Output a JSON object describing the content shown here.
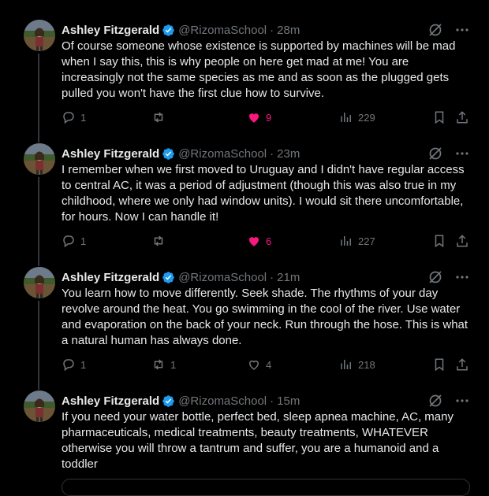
{
  "tweets": [
    {
      "author": "Ashley Fitzgerald",
      "handle": "@RizomaSchool",
      "time": "28m",
      "text": "Of course someone whose existence is supported by machines will be mad when I say this, this is why people on here get mad at me! You are increasingly not the same species as me and as soon as the plugged gets pulled you won't have the first clue how to survive.",
      "replies": "1",
      "reposts": "",
      "likes": "9",
      "liked": true,
      "views": "229"
    },
    {
      "author": "Ashley Fitzgerald",
      "handle": "@RizomaSchool",
      "time": "23m",
      "text": "I remember when we first moved to Uruguay and I didn't have regular access to central AC, it was a period of adjustment (though this was also true in my childhood, where we only had window units). I would sit there uncomfortable, for hours. Now I can handle it!",
      "replies": "1",
      "reposts": "",
      "likes": "6",
      "liked": true,
      "views": "227"
    },
    {
      "author": "Ashley Fitzgerald",
      "handle": "@RizomaSchool",
      "time": "21m",
      "text": "You learn how to move differently. Seek shade. The rhythms of your day revolve around the heat. You go swimming in the cool of the river. Use water and evaporation on the back of your neck. Run through the hose. This is what a natural human has always done.",
      "replies": "1",
      "reposts": "1",
      "likes": "4",
      "liked": false,
      "views": "218"
    },
    {
      "author": "Ashley Fitzgerald",
      "handle": "@RizomaSchool",
      "time": "15m",
      "text": "If you need your water bottle, perfect bed, sleep apnea machine, AC, many pharmaceuticals, medical treatments, beauty treatments, WHATEVER otherwise you will throw a tantrum and suffer, you are a humanoid and a toddler"
    }
  ],
  "separator": "·",
  "colors": {
    "like": "#f91880",
    "verified": "#1d9bf0",
    "muted": "#71767b",
    "text": "#e7e9ea"
  },
  "icons": [
    "verified-badge-icon",
    "grok-icon",
    "more-icon",
    "reply-icon",
    "repost-icon",
    "like-icon",
    "views-icon",
    "bookmark-icon",
    "share-icon"
  ]
}
